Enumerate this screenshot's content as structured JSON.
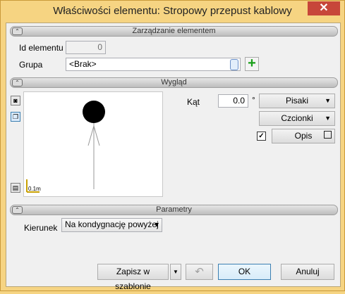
{
  "window": {
    "title": "Właściwości elementu: Stropowy przepust kablowy",
    "close_glyph": "✕"
  },
  "section_management": {
    "label": "Zarządzanie elementem",
    "chevron": "⌃"
  },
  "id_row": {
    "label": "Id elementu",
    "value": "0"
  },
  "group_row": {
    "label": "Grupa",
    "value": "<Brak>",
    "add_glyph": "+"
  },
  "section_appearance": {
    "label": "Wygląd",
    "chevron": "⌃"
  },
  "angle": {
    "label": "Kąt",
    "value": "0.0",
    "unit": "°"
  },
  "pens_button": {
    "label": "Pisaki",
    "arrow": "▼"
  },
  "fonts_button": {
    "label": "Czcionki",
    "arrow": "▼"
  },
  "desc": {
    "checked_glyph": "✓",
    "label": "Opis"
  },
  "preview": {
    "scale_label": "0.1m"
  },
  "section_params": {
    "label": "Parametry",
    "chevron": "⌃"
  },
  "direction": {
    "label": "Kierunek",
    "value": "Na kondygnację powyżej",
    "arrow": "▾"
  },
  "footer": {
    "save_template": "Zapisz w szablonie",
    "arrow": "▼",
    "undo_glyph": "↶",
    "ok": "OK",
    "cancel": "Anuluj"
  }
}
